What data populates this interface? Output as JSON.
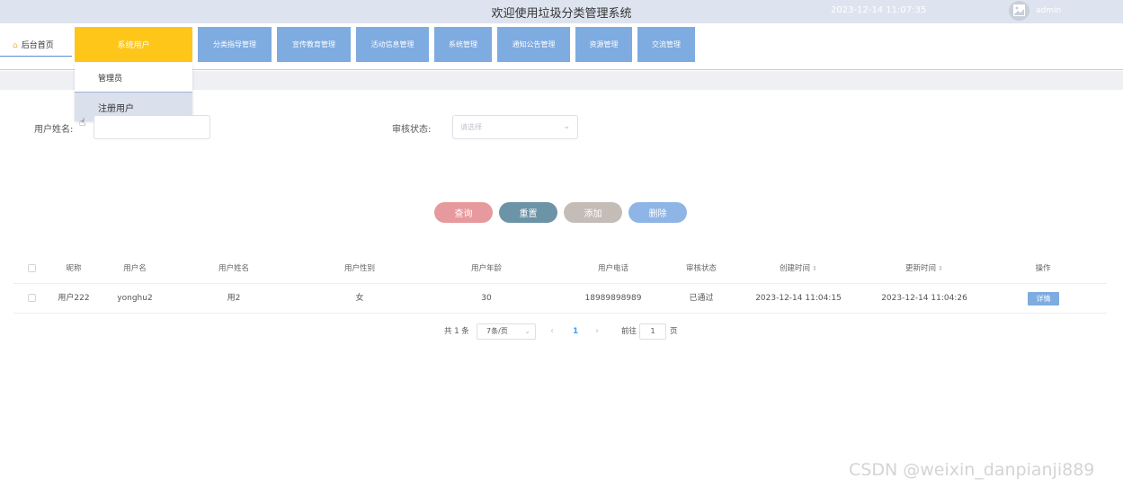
{
  "header": {
    "title": "欢迎使用垃圾分类管理系统",
    "datetime": "2023-12-14 11:07:35",
    "user": "admin"
  },
  "nav": {
    "home": "后台首页",
    "items": [
      {
        "label": "系统用户",
        "active": true
      },
      {
        "label": "分类指导管理"
      },
      {
        "label": "宣传教育管理"
      },
      {
        "label": "活动信息管理"
      },
      {
        "label": "系统管理"
      },
      {
        "label": "通知公告管理"
      },
      {
        "label": "资源管理"
      },
      {
        "label": "交流管理"
      }
    ],
    "dropdown": [
      "管理员",
      "注册用户"
    ]
  },
  "search": {
    "name_label": "用户姓名:",
    "name_value": "",
    "status_label": "审核状态:",
    "status_placeholder": "请选择"
  },
  "buttons": {
    "query": "查询",
    "reset": "重置",
    "add": "添加",
    "delete": "删除"
  },
  "table": {
    "columns": [
      "昵称",
      "用户名",
      "用户姓名",
      "用户性别",
      "用户年龄",
      "用户电话",
      "审核状态",
      "创建时间",
      "更新时间",
      "操作"
    ],
    "rows": [
      {
        "nickname": "用户222",
        "username": "yonghu2",
        "realname": "用2",
        "gender": "女",
        "age": "30",
        "phone": "18989898989",
        "status": "已通过",
        "created": "2023-12-14 11:04:15",
        "updated": "2023-12-14 11:04:26",
        "action": "详情"
      }
    ]
  },
  "pagination": {
    "total": "共 1 条",
    "page_size": "7条/页",
    "current_page": "1",
    "goto_prefix": "前往",
    "goto_value": "1",
    "goto_suffix": "页"
  },
  "watermark": "CSDN @weixin_danpianji889",
  "colors": {
    "header_bg": "#dde4ef",
    "menu_bg": "#7eabe0",
    "menu_active": "#ffc61a",
    "btn_query": "#e79a9e",
    "btn_reset": "#6c93a6",
    "btn_add": "#c4bdb7",
    "btn_delete": "#8eb5e6"
  }
}
